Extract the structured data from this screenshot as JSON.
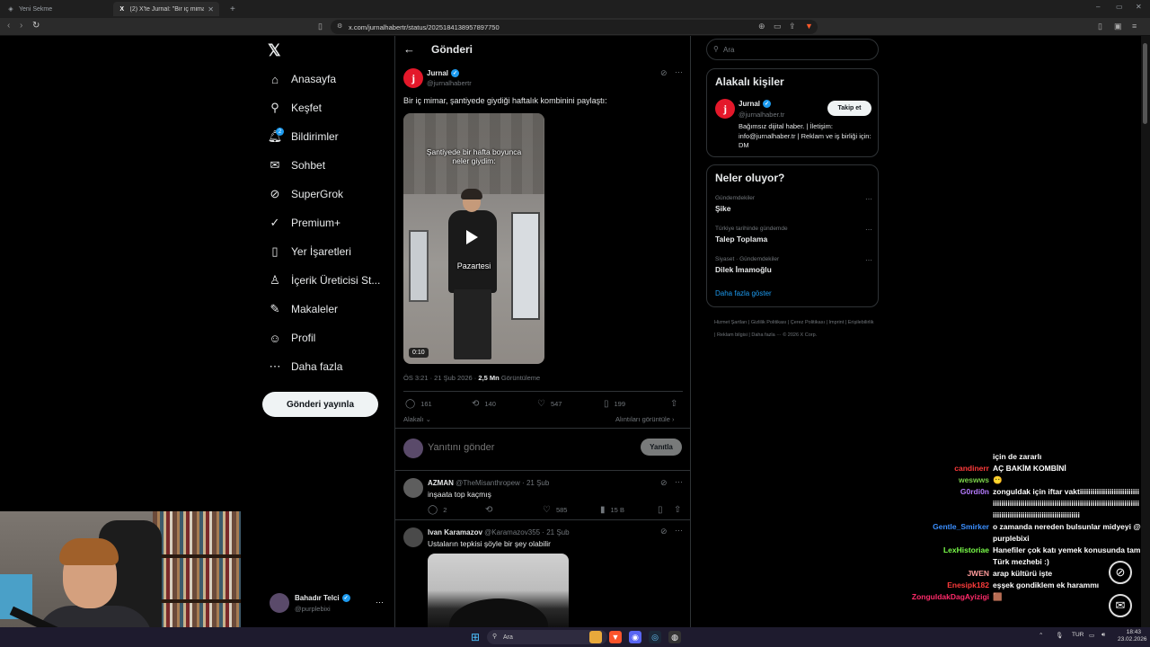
{
  "browser": {
    "tabs": [
      {
        "label": "Yeni Sekme",
        "active": false
      },
      {
        "label": "(2) X'te Jurnal: \"Bir iç mimar, şan...",
        "active": true
      }
    ],
    "new_tab": "+",
    "url": "x.com/jurnalhabertr/status/2025184138957897750",
    "win_controls": {
      "min": "–",
      "max": "▭",
      "close": "✕"
    }
  },
  "nav": {
    "items": [
      {
        "label": "Anasayfa",
        "icon": "home-icon",
        "glyph": "⌂"
      },
      {
        "label": "Keşfet",
        "icon": "search-icon",
        "glyph": "⚲"
      },
      {
        "label": "Bildirimler",
        "icon": "bell-icon",
        "glyph": "🔔︎",
        "badge": "2"
      },
      {
        "label": "Sohbet",
        "icon": "mail-icon",
        "glyph": "✉"
      },
      {
        "label": "SuperGrok",
        "icon": "grok-icon",
        "glyph": "⊘"
      },
      {
        "label": "Premium+",
        "icon": "premium-icon",
        "glyph": "✓"
      },
      {
        "label": "Yer İşaretleri",
        "icon": "bookmark-icon",
        "glyph": "▯"
      },
      {
        "label": "İçerik Üreticisi St...",
        "icon": "creator-icon",
        "glyph": "♙"
      },
      {
        "label": "Makaleler",
        "icon": "articles-icon",
        "glyph": "✎"
      },
      {
        "label": "Profil",
        "icon": "profile-icon",
        "glyph": "☺"
      },
      {
        "label": "Daha fazla",
        "icon": "more-icon",
        "glyph": "⋯"
      }
    ],
    "post_button": "Gönderi yayınla",
    "account": {
      "name": "Bahadır Telci",
      "handle": "@purplebixi",
      "more": "⋯"
    }
  },
  "main": {
    "header": {
      "back": "←",
      "title": "Gönderi"
    },
    "tweet": {
      "author": "Jurnal",
      "handle": "@jurnalhabertr",
      "avatar_letter": "j",
      "text": "Bir iç mimar, şantiyede giydiği haftalık kombinini paylaştı:",
      "video": {
        "caption_top": "Şantiyede bir hafta boyunca neler giydim:",
        "caption_mid": "Pazartesi",
        "duration": "0:10"
      },
      "timestamp": "ÖS 3:21 · 21 Şub 2026 ·",
      "views_count": "2,5 Mn",
      "views_label": "Görüntüleme",
      "actions": {
        "replies": "161",
        "reposts": "140",
        "likes": "547",
        "bookmarks": "199"
      },
      "related": "Alakalı",
      "quotes": "Alıntıları görüntüle"
    },
    "reply_box": {
      "placeholder": "Yanıtını gönder",
      "button": "Yanıtla"
    },
    "replies": [
      {
        "author": "AZMAN",
        "handle": "@TheMisanthropew · 21 Şub",
        "text": "inşaata top kaçmış",
        "replies": "2",
        "reposts": "",
        "likes": "585",
        "views": "15 B"
      },
      {
        "author": "Ivan Karamazov",
        "handle": "@Karamazov355 · 21 Şub",
        "text": "Ustaların tepkisi şöyle bir şey olabilir"
      }
    ]
  },
  "sidebar": {
    "search_placeholder": "Ara",
    "who": {
      "title": "Alakalı kişiler",
      "name": "Jurnal",
      "handle": "@jurnalhaber.tr",
      "follow": "Takip et",
      "bio": "Bağımsız dijital haber. | İletişim: info@jurnalhaber.tr | Reklam ve iş birliği için: DM"
    },
    "trends": {
      "title": "Neler oluyor?",
      "items": [
        {
          "meta": "Gündemdekiler",
          "name": "Şike"
        },
        {
          "meta": "Türkiye tarihinde gündemde",
          "name": "Talep Toplama"
        },
        {
          "meta": "Siyaset · Gündemdekiler",
          "name": "Dilek İmamoğlu"
        }
      ],
      "more": "Daha fazla göster"
    },
    "footer": "Hizmet Şartları | Gizlilik Politikası | Çerez Politikası | Imprint | Erişilebilirlik | Reklam bilgisi | Daha fazla ··· © 2026 X Corp."
  },
  "chat": [
    {
      "user": "",
      "msg": "için de zararlı",
      "color": "#ffffff"
    },
    {
      "user": "candinerr",
      "msg": "AÇ BAKİM KOMBİNİ",
      "color": "#ff3b3b"
    },
    {
      "user": "weswws",
      "msg": "😶",
      "color": "#7bd14a"
    },
    {
      "user": "G0rdi0n",
      "msg": "zonguldak için iftar vaktiiiiiiiiiiiiiiiiiiiiiiiiiiiiiiiiiiiiiiiiiiiiiiiiiiiiiiiiiiiiiiiiiiiiiiiiiiiiiiiiiiiiiiiiiiiiiiiiiiiiiiiiiiiiiiiiiiiiiiiiiiiiiiiiiiiiiiiiii",
      "color": "#b57bff"
    },
    {
      "user": "Gentle_Smirker",
      "msg": "o zamanda nereden bulsunlar midyeyi @purplebixi",
      "color": "#3b8fff"
    },
    {
      "user": "LexHistoriae",
      "msg": "Hanefiler çok katı yemek konusunda tam Türk mezhebi :)",
      "color": "#7bff4a"
    },
    {
      "user": "JWEN",
      "msg": "arap kültürü işte",
      "color": "#ff9a9a"
    },
    {
      "user": "Enesipk182",
      "msg": "eşşek gondiklem ek harammı",
      "color": "#ff3b3b"
    },
    {
      "user": "ZonguldakDagAyizigi",
      "msg": "🟫",
      "color": "#ff2a6a"
    }
  ],
  "taskbar": {
    "search": "Ara",
    "lang": "TUR",
    "time": "18:43",
    "date": "23.02.2026"
  }
}
